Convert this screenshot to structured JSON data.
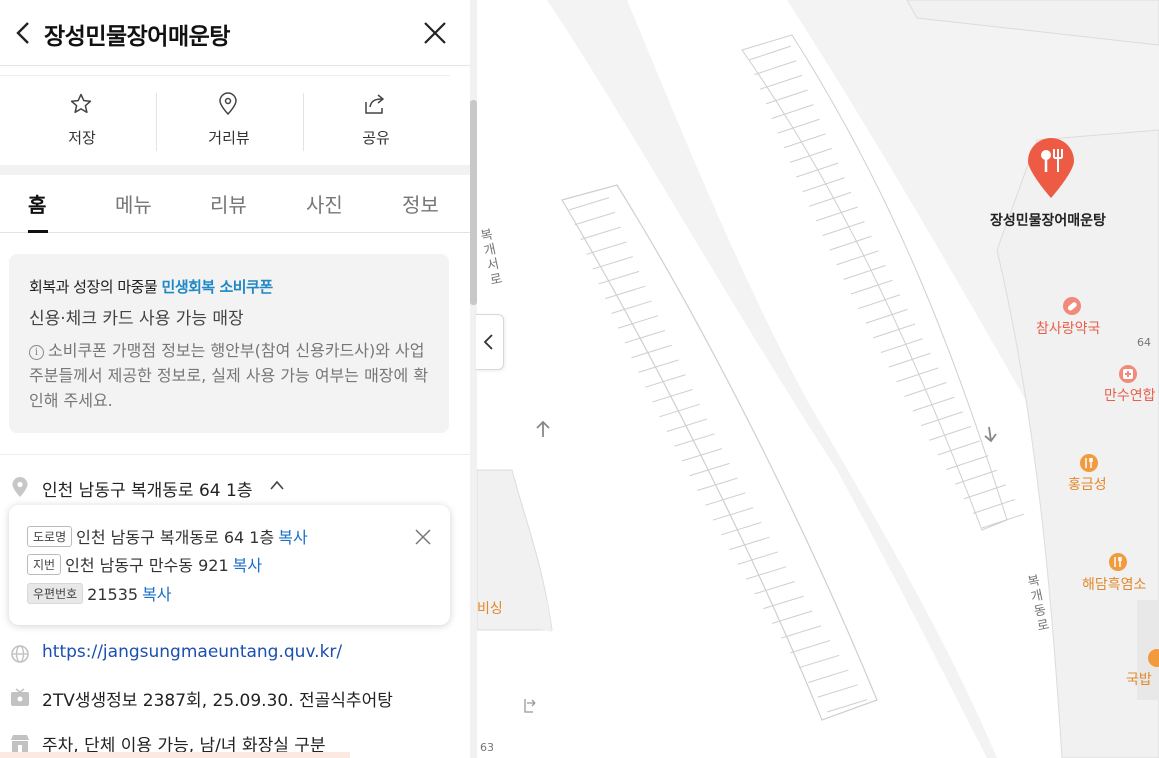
{
  "header": {
    "title": "장성민물장어매운탕"
  },
  "actions": [
    {
      "label": "저장",
      "icon": "star-icon"
    },
    {
      "label": "거리뷰",
      "icon": "location-pin-icon"
    },
    {
      "label": "공유",
      "icon": "share-icon"
    }
  ],
  "tabs": [
    {
      "label": "홈",
      "active": true
    },
    {
      "label": "메뉴"
    },
    {
      "label": "리뷰"
    },
    {
      "label": "사진"
    },
    {
      "label": "정보"
    }
  ],
  "coupon": {
    "line1_prefix": "회복과 성장의 마중물 ",
    "line1_highlight": "민생회복 소비쿠폰",
    "line2": "신용·체크 카드 사용 가능 매장",
    "note_icon": "i",
    "note": "소비쿠폰 가맹점 정보는 행안부(참여 신용카드사)와 사업주분들께서 제공한 정보로, 실제 사용 가능 여부는 매장에 확인해 주세요.",
    "highlight_color": "#1f88c5"
  },
  "address": {
    "summary": "인천 남동구 복개동로 64 1층",
    "road": {
      "badge": "도로명",
      "value": "인천 남동구 복개동로 64 1층",
      "copy": "복사"
    },
    "lot": {
      "badge": "지번",
      "value": "인천 남동구 만수동 921",
      "copy": "복사"
    },
    "zip": {
      "badge": "우편번호",
      "value": "21535",
      "copy": "복사"
    }
  },
  "info": {
    "website": "https://jangsungmaeuntang.quv.kr/",
    "tv": "2TV생생정보 2387회, 25.09.30. 전골식추어탕",
    "facilities": "주차, 단체 이용 가능, 남/녀 화장실 구분"
  },
  "map": {
    "selected_place": "장성민물장어매운탕",
    "pois": {
      "pharmacy": "참사랑약국",
      "building_number_64": "64",
      "manshu": "만수연합",
      "hongkeum": "홍금성",
      "haedam": "해담흑염소",
      "gukbap": "국밥",
      "left_poi": "비싱",
      "building_number_63": "63"
    },
    "roads": {
      "bokgaeseo": "복개서로",
      "bokgaedong": "복개동로"
    },
    "marker_color": "#ee5b45"
  }
}
